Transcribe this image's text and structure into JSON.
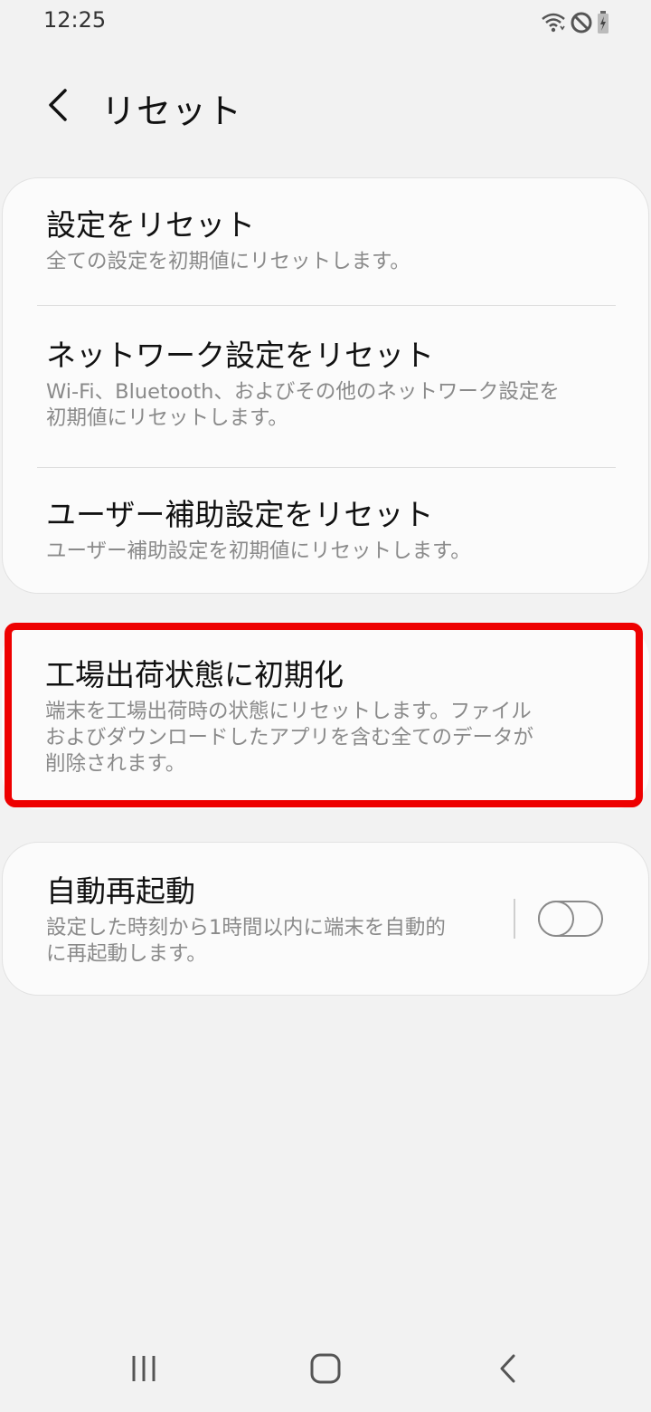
{
  "status_bar": {
    "time": "12:25",
    "icons": [
      "wifi-icon",
      "do-not-disturb-icon",
      "battery-charging-icon"
    ]
  },
  "app_bar": {
    "back_icon": "chevron-left-icon",
    "title": "リセット"
  },
  "groups": [
    {
      "items": [
        {
          "title": "設定をリセット",
          "subtitle": "全ての設定を初期値にリセットします。"
        },
        {
          "title": "ネットワーク設定をリセット",
          "subtitle_lines": [
            "Wi-Fi、Bluetooth、およびその他のネットワーク設定を",
            "初期値にリセットします。"
          ]
        },
        {
          "title": "ユーザー補助設定をリセット",
          "subtitle": "ユーザー補助設定を初期値にリセットします。"
        }
      ]
    },
    {
      "items": [
        {
          "title": "工場出荷状態に初期化",
          "subtitle_lines": [
            "端末を工場出荷時の状態にリセットします。ファイル",
            "およびダウンロードしたアプリを含む全てのデータが",
            "削除されます。"
          ],
          "highlighted": true,
          "highlight_color": "#ee0000"
        }
      ]
    },
    {
      "items": [
        {
          "title": "自動再起動",
          "subtitle_lines": [
            "設定した時刻から1時間以内に端末を自動的",
            "に再起動します。"
          ],
          "toggle": "off"
        }
      ]
    }
  ],
  "nav_bar": {
    "buttons": [
      "recent-apps-icon",
      "home-icon",
      "back-icon"
    ]
  }
}
